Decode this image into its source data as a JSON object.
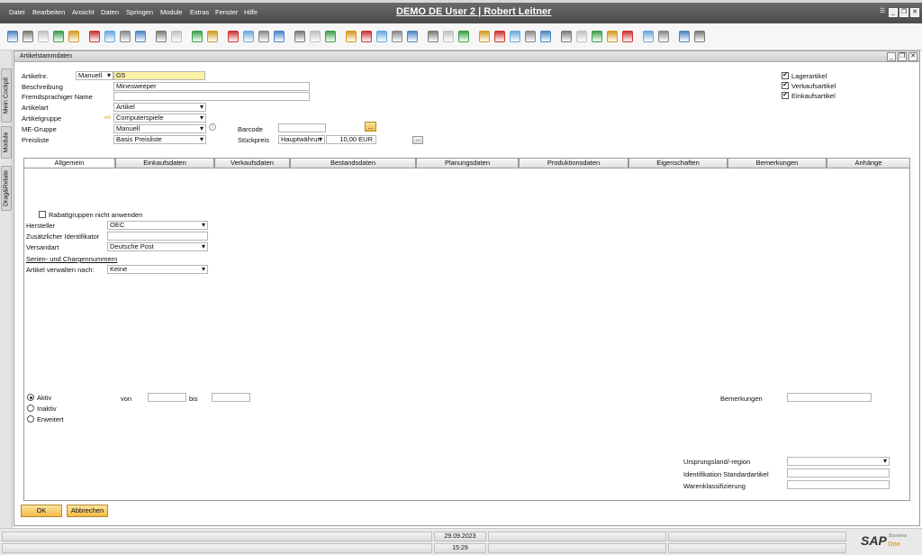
{
  "menu": {
    "items": [
      "Datei",
      "Bearbeiten",
      "Ansicht",
      "Daten",
      "Springen",
      "Module",
      "Extras",
      "Fenster",
      "Hilfe"
    ],
    "title": "DEMO DE User 2 | Robert Leitner"
  },
  "toolbar": {
    "icons": [
      "preview-icon",
      "print-icon",
      "email-icon",
      "sms-icon",
      "fax-icon",
      "export-icon",
      "excel-icon",
      "word-icon",
      "pdf-icon",
      "launch-icon",
      "lock-icon",
      "find-icon",
      "add-icon",
      "first-icon",
      "prev-icon",
      "next-icon",
      "last-icon",
      "refresh-icon",
      "filter-icon",
      "sort-icon",
      "base-doc-icon",
      "target-doc-icon",
      "copy-icon",
      "paste-icon",
      "draw-icon",
      "gross-profit-icon",
      "volume-icon",
      "chart-icon",
      "edit-icon",
      "new-doc-icon",
      "approve-icon",
      "message-icon",
      "chat-icon",
      "calendar-icon",
      "alerts-icon",
      "dashboard-icon",
      "org-icon",
      "user-icon",
      "settings-icon",
      "help-icon",
      "form-icon",
      "layout-icon"
    ]
  },
  "side_tabs": [
    "Mein Cockpit",
    "Module",
    "Drag&Relate"
  ],
  "window": {
    "title": "Artikelstammdaten"
  },
  "header": {
    "artikelnr_label": "Artikelnr.",
    "series_value": "Manuell",
    "artikelnr_value": "G5",
    "beschreibung_label": "Beschreibung",
    "beschreibung_value": "Minesweeper",
    "fremd_label": "Fremdsprachiger Name",
    "fremd_value": "",
    "artikelart_label": "Artikelart",
    "artikelart_value": "Artikel",
    "artikelgruppe_label": "Artikelgruppe",
    "artikelgruppe_value": "Computerspiele",
    "me_label": "ME-Gruppe",
    "me_value": "Manuell",
    "preisliste_label": "Preisliste",
    "preisliste_value": "Basis Preisliste",
    "barcode_label": "Barcode",
    "barcode_value": "",
    "barcode_btn": "...",
    "stueckpreis_label": "Stückpreis",
    "waehrung_value": "Hauptwährun",
    "preis_value": "10,00 EUR",
    "preis_btn": "...",
    "checkboxes": [
      {
        "label": "Lagerartikel",
        "checked": true
      },
      {
        "label": "Verkaufsartikel",
        "checked": true
      },
      {
        "label": "Einkaufsartikel",
        "checked": true
      }
    ]
  },
  "tabs": [
    "Allgemein",
    "Einkaufsdaten",
    "Verkaufsdaten",
    "Bestandsdaten",
    "Planungsdaten",
    "Produktionsdaten",
    "Eigenschaften",
    "Bemerkungen",
    "Anhänge"
  ],
  "general": {
    "rabatt_label": "Rabattgruppen nicht anwenden",
    "hersteller_label": "Hersteller",
    "hersteller_value": "OEC",
    "zusatz_label": "Zusätzlicher Identifikator",
    "zusatz_value": "",
    "versandart_label": "Versandart",
    "versandart_value": "Deutsche Post",
    "serien_link": "Serien- und Chargennummern",
    "verwalten_label": "Artikel verwalten nach:",
    "verwalten_value": "Keine",
    "status_options": [
      {
        "label": "Aktiv",
        "selected": true
      },
      {
        "label": "Inaktiv",
        "selected": false
      },
      {
        "label": "Erweitert",
        "selected": false
      }
    ],
    "von_label": "von",
    "bis_label": "bis",
    "bemerkungen_label": "Bemerkungen",
    "ursprung_label": "Ursprungsland/-region",
    "identifikation_label": "Identifikation Standardartikel",
    "warenklass_label": "Warenklassifizierung"
  },
  "buttons": {
    "ok": "OK",
    "cancel": "Abbrechen"
  },
  "status": {
    "date": "29.09.2023",
    "time": "15:29"
  },
  "brand": {
    "logo": "SAP",
    "sub": "One",
    "sup": "Business"
  },
  "colors": {
    "accent": "#f4b942",
    "title_bar": "#555555",
    "field_highlight": "#fdf1a6"
  }
}
